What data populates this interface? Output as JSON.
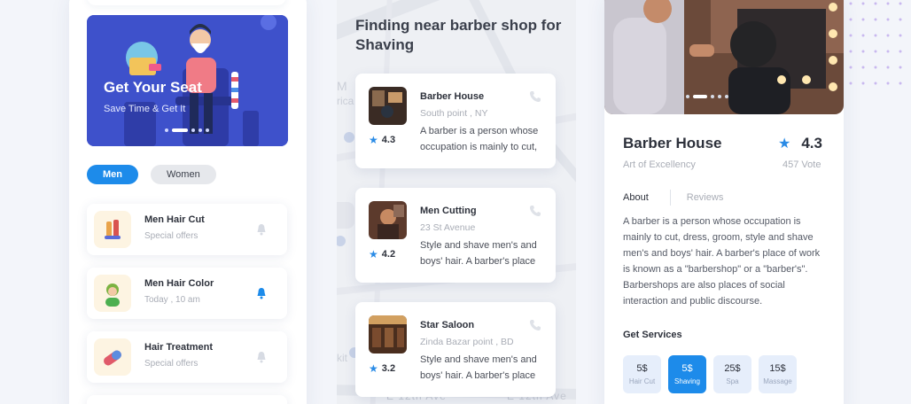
{
  "banner": {
    "title": "Get Your Seat",
    "subtitle": "Save Time & Get It"
  },
  "gender_tabs": [
    {
      "label": "Men",
      "active": true
    },
    {
      "label": "Women",
      "active": false
    }
  ],
  "services_list": [
    {
      "name": "Men Hair Cut",
      "meta": "Special offers",
      "icon": "scissors-icon",
      "bell_active": false
    },
    {
      "name": "Men Hair Color",
      "meta": "Today , 10 am",
      "icon": "person-icon",
      "bell_active": true
    },
    {
      "name": "Hair Treatment",
      "meta": "Special offers",
      "icon": "pill-icon",
      "bell_active": false
    }
  ],
  "map": {
    "title": "Finding near  barber shop for Shaving",
    "street_label": "E 12th Ave"
  },
  "shops": [
    {
      "name": "Barber House",
      "location": "South point , NY",
      "rating": "4.3",
      "description": "A barber is a person whose occupation is mainly to cut,"
    },
    {
      "name": "Men Cutting",
      "location": "23 St Avenue",
      "rating": "4.2",
      "description": "Style and shave men's and boys' hair. A barber's place"
    },
    {
      "name": "Star Saloon",
      "location": "Zinda Bazar point , BD",
      "rating": "3.2",
      "description": "Style and shave men's and boys' hair. A barber's place"
    }
  ],
  "detail": {
    "title": "Barber House",
    "rating": "4.3",
    "subtitle": "Art of Excellency",
    "votes": "457 Vote",
    "tabs": {
      "about": "About",
      "reviews": "Reviews"
    },
    "about_text": "A barber is a person whose occupation is mainly to cut, dress, groom, style and shave men's and boys' hair. A barber's place of work is known as a \"barbershop\" or a \"barber's\". Barbershops are also places of social interaction and public discourse.",
    "services_heading": "Get Services",
    "services": [
      {
        "price": "5$",
        "label": "Hair Cut",
        "active": false
      },
      {
        "price": "5$",
        "label": "Shaving",
        "active": true
      },
      {
        "price": "25$",
        "label": "Spa",
        "active": false
      },
      {
        "price": "15$",
        "label": "Massage",
        "active": false
      }
    ]
  },
  "colors": {
    "accent": "#1d8bea",
    "banner": "#3f52cc",
    "background": "#f3f5fa"
  }
}
